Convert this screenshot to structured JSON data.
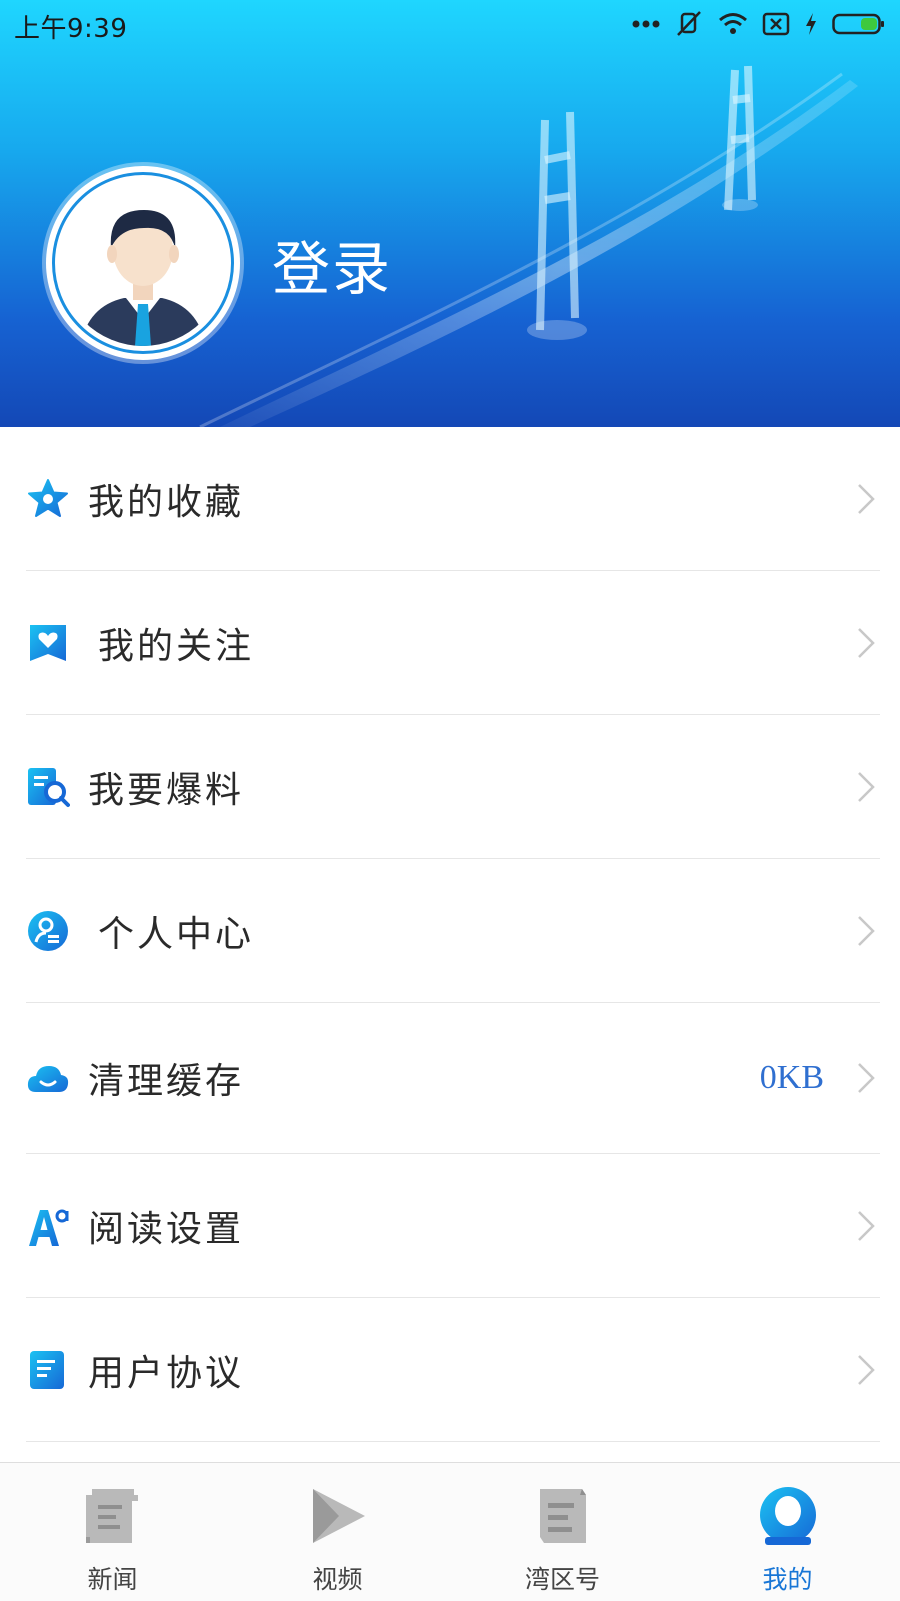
{
  "status_bar": {
    "time": "上午9:39",
    "icons": [
      "more-dots-icon",
      "mute-icon",
      "wifi-icon",
      "sim-icon",
      "charging-icon",
      "battery-icon"
    ]
  },
  "header": {
    "login_label": "登录",
    "avatar_icon": "user-avatar-icon"
  },
  "menu": {
    "items": [
      {
        "label": "我的收藏",
        "icon": "star-icon"
      },
      {
        "label": "我的关注",
        "icon": "heart-bookmark-icon"
      },
      {
        "label": "我要爆料",
        "icon": "report-search-icon"
      },
      {
        "label": "个人中心",
        "icon": "profile-icon"
      },
      {
        "label": "清理缓存",
        "icon": "cloud-icon",
        "value": "0KB"
      },
      {
        "label": "阅读设置",
        "icon": "font-size-icon"
      },
      {
        "label": "用户协议",
        "icon": "document-icon"
      }
    ]
  },
  "tabbar": {
    "tabs": [
      {
        "label": "新闻",
        "icon": "news-scroll-icon",
        "active": false
      },
      {
        "label": "视频",
        "icon": "video-play-icon",
        "active": false
      },
      {
        "label": "湾区号",
        "icon": "bay-area-icon",
        "active": false
      },
      {
        "label": "我的",
        "icon": "my-profile-icon",
        "active": true
      }
    ]
  },
  "colors": {
    "accent": "#1876d6",
    "header_top": "#1fd6ff",
    "header_bottom": "#1448b6",
    "cache_value": "#2f6fd0"
  }
}
